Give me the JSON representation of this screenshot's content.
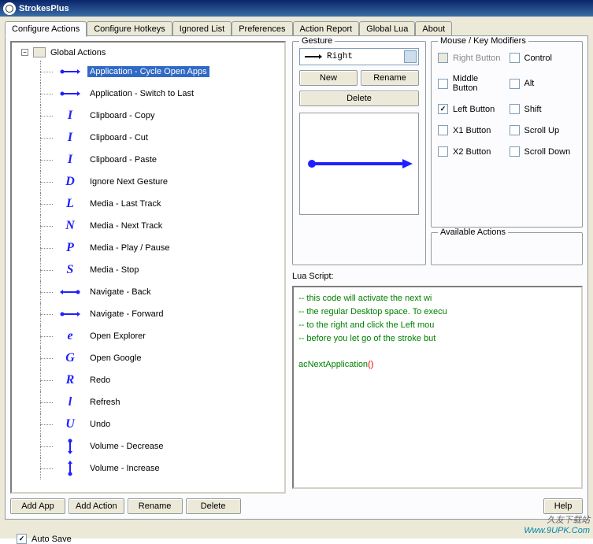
{
  "window": {
    "title": "StrokesPlus"
  },
  "tabs": [
    {
      "label": "Configure Actions",
      "active": true
    },
    {
      "label": "Configure Hotkeys"
    },
    {
      "label": "Ignored List"
    },
    {
      "label": "Preferences"
    },
    {
      "label": "Action Report"
    },
    {
      "label": "Global Lua"
    },
    {
      "label": "About"
    }
  ],
  "tree": {
    "root": "Global Actions",
    "items": [
      {
        "label": "Application - Cycle Open Apps",
        "selected": true,
        "glyph": "right"
      },
      {
        "label": "Application - Switch to Last",
        "glyph": "right"
      },
      {
        "label": "Clipboard - Copy",
        "glyph": "I"
      },
      {
        "label": "Clipboard - Cut",
        "glyph": "I"
      },
      {
        "label": "Clipboard - Paste",
        "glyph": "I"
      },
      {
        "label": "Ignore Next Gesture",
        "glyph": "D"
      },
      {
        "label": "Media - Last Track",
        "glyph": "L"
      },
      {
        "label": "Media - Next Track",
        "glyph": "N"
      },
      {
        "label": "Media - Play / Pause",
        "glyph": "P"
      },
      {
        "label": "Media - Stop",
        "glyph": "S"
      },
      {
        "label": "Navigate - Back",
        "glyph": "left"
      },
      {
        "label": "Navigate - Forward",
        "glyph": "right"
      },
      {
        "label": "Open Explorer",
        "glyph": "e"
      },
      {
        "label": "Open Google",
        "glyph": "G"
      },
      {
        "label": "Redo",
        "glyph": "R"
      },
      {
        "label": "Refresh",
        "glyph": "l"
      },
      {
        "label": "Undo",
        "glyph": "U"
      },
      {
        "label": "Volume - Decrease",
        "glyph": "down"
      },
      {
        "label": "Volume - Increase",
        "glyph": "up"
      }
    ]
  },
  "buttons": {
    "addApp": "Add App",
    "addAction": "Add Action",
    "rename": "Rename",
    "delete": "Delete",
    "new": "New",
    "help": "Help"
  },
  "gesture": {
    "title": "Gesture",
    "selected": "Right",
    "rename": "Rename",
    "delete": "Delete"
  },
  "modifiers": {
    "title": "Mouse / Key Modifiers",
    "items": [
      {
        "label": "Right Button",
        "checked": false,
        "disabled": true
      },
      {
        "label": "Control",
        "checked": false
      },
      {
        "label": "Middle Button",
        "checked": false
      },
      {
        "label": "Alt",
        "checked": false
      },
      {
        "label": "Left Button",
        "checked": true
      },
      {
        "label": "Shift",
        "checked": false
      },
      {
        "label": "X1 Button",
        "checked": false
      },
      {
        "label": "Scroll Up",
        "checked": false
      },
      {
        "label": "X2 Button",
        "checked": false
      },
      {
        "label": "Scroll Down",
        "checked": false
      }
    ]
  },
  "available": {
    "title": "Available Actions"
  },
  "lua": {
    "label": "Lua Script:",
    "lines": [
      "-- this code will activate the next wi",
      "-- the regular Desktop space. To execu",
      "-- to the right and click the Left mou",
      "-- before you let go of the stroke but",
      "",
      "acNextApplication()"
    ]
  },
  "autosave": {
    "label": "Auto Save",
    "checked": true
  },
  "watermark": {
    "line1": "久友下载站",
    "line2": "Www.9UPK.Com"
  }
}
